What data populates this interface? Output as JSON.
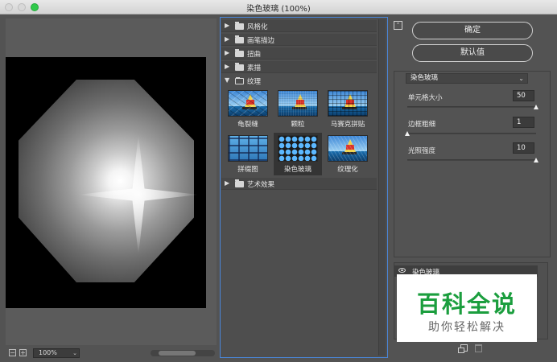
{
  "window": {
    "title": "染色玻璃 (100%)"
  },
  "preview": {
    "zoom": "100%",
    "zoom_out": "−",
    "zoom_in": "+"
  },
  "gallery": {
    "categories_top": [
      "风格化",
      "画笔描边",
      "扭曲",
      "素描",
      "纹理"
    ],
    "expanded_category": "纹理",
    "thumbnails": [
      {
        "label": "龟裂缝"
      },
      {
        "label": "颗粒"
      },
      {
        "label": "马赛克拼贴"
      },
      {
        "label": "拼缀图"
      },
      {
        "label": "染色玻璃",
        "selected": true
      },
      {
        "label": "纹理化"
      }
    ],
    "categories_bottom": [
      "艺术效果"
    ]
  },
  "buttons": {
    "ok": "确定",
    "default": "默认值"
  },
  "settings": {
    "filter": "染色玻璃",
    "params": [
      {
        "label": "单元格大小",
        "value": "50",
        "level": 1.0
      },
      {
        "label": "边框粗细",
        "value": "1",
        "level": 0.0
      },
      {
        "label": "光照强度",
        "value": "10",
        "level": 1.0
      }
    ]
  },
  "layers": {
    "items": [
      "染色玻璃"
    ]
  },
  "watermark": {
    "title": "百科全说",
    "subtitle": "助你轻松解决"
  },
  "colors": {
    "selection_border": "#4a86d8",
    "watermark_green": "#1b9e3e"
  },
  "icons": {
    "collapse": "collapse-icon",
    "eye": "eye-icon",
    "new_layer": "new-layer-icon",
    "trash": "trash-icon",
    "folder": "folder-icon"
  }
}
